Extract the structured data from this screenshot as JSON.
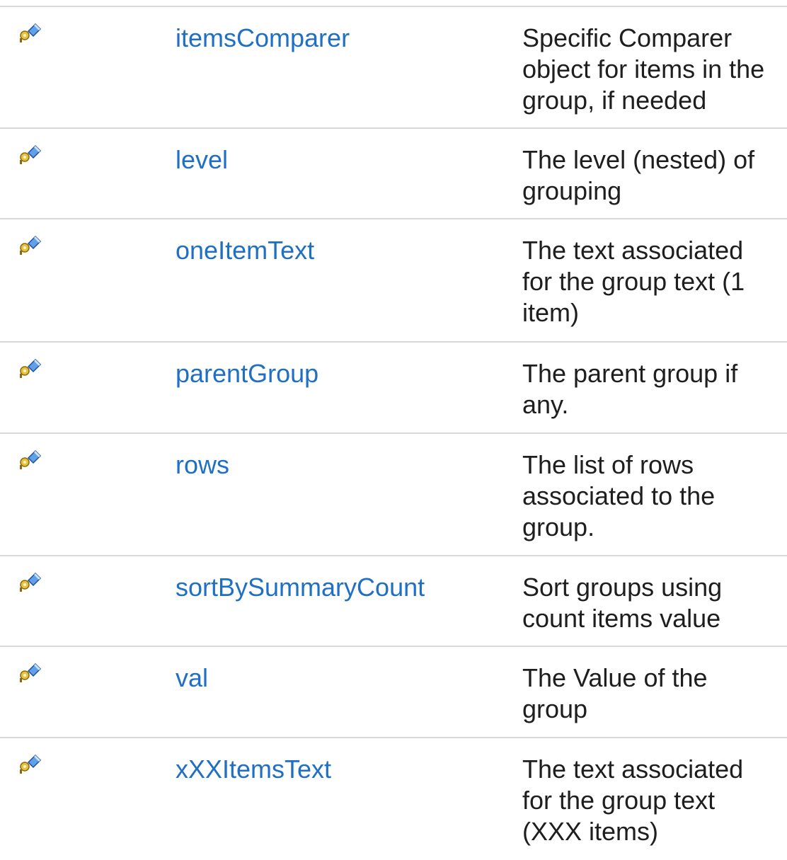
{
  "members": {
    "icon": "field-key-icon",
    "rows": [
      {
        "name": "itemsComparer",
        "description": "Specific Comparer\nobject for items in the\ngroup, if needed"
      },
      {
        "name": "level",
        "description": "The level (nested) of\ngrouping"
      },
      {
        "name": "oneItemText",
        "description": "The text associated\nfor the group text (1\nitem)"
      },
      {
        "name": "parentGroup",
        "description": "The parent group if\nany."
      },
      {
        "name": "rows",
        "description": "The list of rows\nassociated to the\ngroup."
      },
      {
        "name": "sortBySummaryCount",
        "description": "Sort groups using\ncount items value"
      },
      {
        "name": "val",
        "description": "The Value of the\ngroup"
      },
      {
        "name": "xXXItemsText",
        "description": "The text associated\nfor the group text\n(XXX items)"
      }
    ]
  },
  "colors": {
    "link": "#1f6fc5",
    "text": "#1e1e1e",
    "divider": "#d9d9d9"
  }
}
